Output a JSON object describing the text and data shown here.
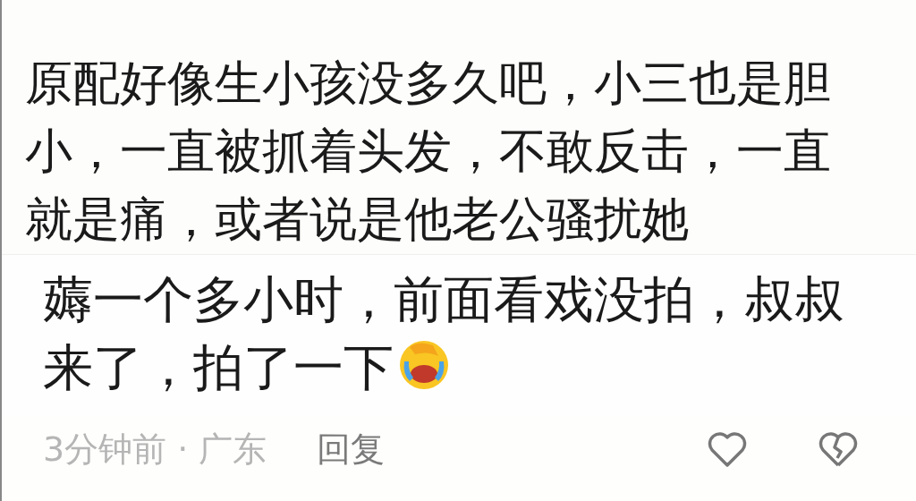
{
  "comment": {
    "text": "原配好像生小孩没多久吧，小三也是胆小，一直被抓着头发，不敢反击，一直就是痛，或者说是他老公骚扰她"
  },
  "reply": {
    "text": "薅一个多小时，前面看戏没拍，叔叔来了，拍了一下"
  },
  "footer": {
    "time": "3分钟前",
    "separator": "·",
    "location": "广东",
    "reply_label": "回复"
  }
}
